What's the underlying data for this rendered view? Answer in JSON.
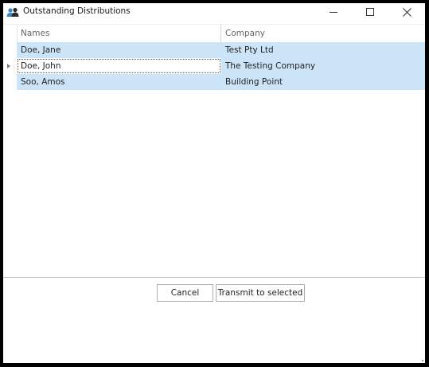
{
  "window": {
    "title": "Outstanding Distributions"
  },
  "titlebar_buttons": {
    "minimize_icon": "minimize-icon",
    "maximize_icon": "maximize-icon",
    "close_icon": "close-icon"
  },
  "grid": {
    "columns": [
      "Names",
      "Company"
    ],
    "rows": [
      {
        "name": "Doe, Jane",
        "company": "Test Pty Ltd"
      },
      {
        "name": "Doe, John",
        "company": "The Testing Company"
      },
      {
        "name": "Soo, Amos",
        "company": "Building Point"
      }
    ],
    "current_row": 2
  },
  "buttons": {
    "cancel": "Cancel",
    "transmit": "Transmit to selected"
  },
  "colors": {
    "selection": "#cce4f7",
    "frame": "#000000"
  }
}
